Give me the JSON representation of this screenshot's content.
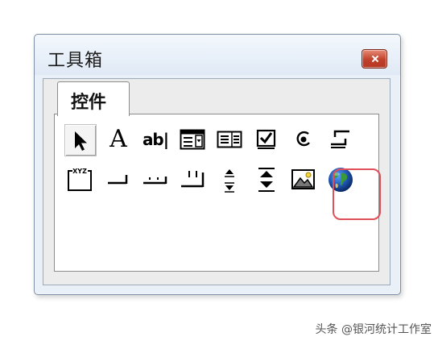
{
  "window": {
    "title": "工具箱"
  },
  "tabs": [
    {
      "label": "控件"
    }
  ],
  "toolbox": {
    "row1": [
      {
        "name": "pointer",
        "icon": "arrow-pointer-icon"
      },
      {
        "name": "label",
        "icon": "label-A-icon",
        "glyph": "A"
      },
      {
        "name": "textbox",
        "icon": "textbox-ab-icon",
        "glyph": "ab|"
      },
      {
        "name": "combobox",
        "icon": "combobox-icon"
      },
      {
        "name": "listbox",
        "icon": "listbox-icon"
      },
      {
        "name": "checkbox",
        "icon": "checkbox-icon"
      },
      {
        "name": "optionbutton",
        "icon": "radio-button-icon"
      },
      {
        "name": "togglebutton",
        "icon": "toggle-button-icon"
      }
    ],
    "row2": [
      {
        "name": "frame",
        "icon": "frame-icon",
        "glyph": "XYZ"
      },
      {
        "name": "commandbutton",
        "icon": "command-button-icon"
      },
      {
        "name": "tabstrip",
        "icon": "tabstrip-icon"
      },
      {
        "name": "multipage",
        "icon": "multipage-icon"
      },
      {
        "name": "scrollbar",
        "icon": "scrollbar-icon"
      },
      {
        "name": "spinbutton",
        "icon": "spin-button-icon"
      },
      {
        "name": "image",
        "icon": "image-icon"
      },
      {
        "name": "webbrowser",
        "icon": "globe-icon"
      }
    ]
  },
  "watermark": "头条 @银河统计工作室",
  "colors": {
    "close": "#c0412a",
    "annotation": "#e0505a",
    "globe_blue": "#1f55b3",
    "globe_green": "#3a9a3a"
  }
}
